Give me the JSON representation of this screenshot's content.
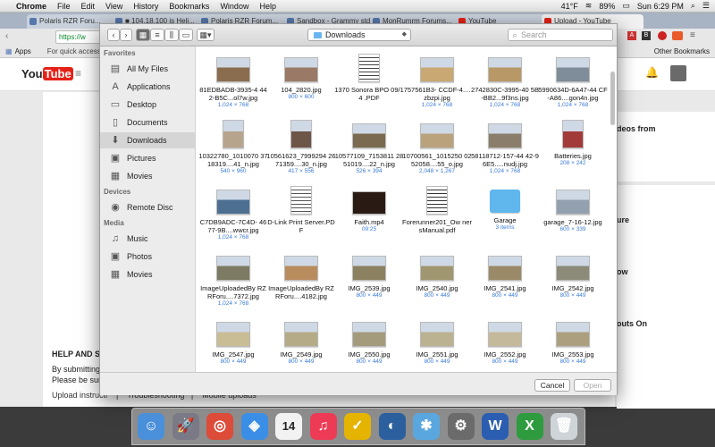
{
  "menubar": {
    "app": "Chrome",
    "items": [
      "File",
      "Edit",
      "View",
      "History",
      "Bookmarks",
      "Window",
      "Help"
    ],
    "temp": "41°F",
    "battery": "89%",
    "clock": "Sun 6:29 PM"
  },
  "browser": {
    "tabs": [
      "Polaris RZR Foru...",
      "■ 104.18.100 is Heli...",
      "Polaris RZR Forum...",
      "Sandbox - Grammy stde",
      "MonRumrm Forums...",
      "YouTube",
      ""
    ],
    "last_tab": "Upload - YouTube",
    "address_prefix": "https://w",
    "bookmarks_apps": "Apps",
    "bookmarks_hint": "For quick access, pl",
    "other_bookmarks": "Other Bookmarks"
  },
  "youtube": {
    "logo_you": "You",
    "logo_tube": "Tube",
    "side_texts": [
      "deos from",
      "ure",
      "ow",
      "outs On"
    ],
    "help_title": "HELP AND SU",
    "help_lines": [
      "By submitting",
      "Please be sur"
    ],
    "help_links": "Upload instructi    |    Troubleshooting   |    Mobile uploads"
  },
  "dialog": {
    "location": "Downloads",
    "search_placeholder": "Search",
    "sidebar": {
      "favorites_label": "Favorites",
      "favorites": [
        {
          "label": "All My Files",
          "icon": "all-files-icon",
          "glyph": "▤"
        },
        {
          "label": "Applications",
          "icon": "applications-icon",
          "glyph": "A"
        },
        {
          "label": "Desktop",
          "icon": "desktop-icon",
          "glyph": "▭"
        },
        {
          "label": "Documents",
          "icon": "documents-icon",
          "glyph": "▯"
        },
        {
          "label": "Downloads",
          "icon": "downloads-icon",
          "glyph": "⬇"
        },
        {
          "label": "Pictures",
          "icon": "pictures-icon",
          "glyph": "▣"
        },
        {
          "label": "Movies",
          "icon": "movies-icon",
          "glyph": "▦"
        }
      ],
      "devices_label": "Devices",
      "devices": [
        {
          "label": "Remote Disc",
          "icon": "disc-icon",
          "glyph": "◉"
        }
      ],
      "media_label": "Media",
      "media": [
        {
          "label": "Music",
          "icon": "music-icon",
          "glyph": "♫"
        },
        {
          "label": "Photos",
          "icon": "photos-icon",
          "glyph": "▣"
        },
        {
          "label": "Movies",
          "icon": "movies-icon",
          "glyph": "▦"
        }
      ]
    },
    "files": [
      {
        "name": "81EDBADB-3935-4 442-B5C...ol7w.jpg",
        "meta": "1,024 × 768",
        "kind": "photo",
        "color": "#8a6d4f"
      },
      {
        "name": "104_2820.jpg",
        "meta": "800 × 600",
        "kind": "photo",
        "color": "#9a7a66"
      },
      {
        "name": "1370 Sonora BPO 09/14 .PDF",
        "meta": "",
        "kind": "pdf",
        "color": "#444444"
      },
      {
        "name": "757561B3- CCDF-4....zbzpi.jpg",
        "meta": "1,024 × 768",
        "kind": "photo",
        "color": "#c9a873"
      },
      {
        "name": "2742830C-3995-40 5B-BB2...9f3ns.jpg",
        "meta": "1,024 × 768",
        "kind": "photo",
        "color": "#b79866"
      },
      {
        "name": "5990634D-6A47-44 CF-A86....gon4n.jpg",
        "meta": "1,024 × 768",
        "kind": "photo",
        "color": "#7f8c99"
      },
      {
        "name": "10322780_1010070 3718319....41_n.jpg",
        "meta": "540 × 960",
        "kind": "photo",
        "color": "#b7a48d"
      },
      {
        "name": "10561623_7999294 2671359....30_n.jpg",
        "meta": "417 × 556",
        "kind": "photo",
        "color": "#6d5548"
      },
      {
        "name": "10577109_7153811 2851019....22_n.jpg",
        "meta": "526 × 394",
        "kind": "photo",
        "color": "#7a6a50"
      },
      {
        "name": "10700561_1015250 0252058....55_o.jpg",
        "meta": "2,048 × 1,267",
        "kind": "photo",
        "color": "#b9a27c"
      },
      {
        "name": "58118712-157-44 42-96E5.....nudj.jpg",
        "meta": "1,024 × 768",
        "kind": "photo",
        "color": "#8b7d6b"
      },
      {
        "name": "Batteries.jpg",
        "meta": "208 × 242",
        "kind": "photo",
        "color": "#a33a3a"
      },
      {
        "name": "C7DB9ADC-7C4D- 4677-9B....wwcr.jpg",
        "meta": "1,024 × 768",
        "kind": "photo",
        "color": "#4d6f92"
      },
      {
        "name": "D-Link Print Server.PDF",
        "meta": "",
        "kind": "pdf",
        "color": "#555555"
      },
      {
        "name": "Faith.mp4",
        "meta": "09:25",
        "kind": "video",
        "color": "#2a1a14"
      },
      {
        "name": "Forerunner201_Ow nersManual.pdf",
        "meta": "",
        "kind": "doc",
        "color": "#333333"
      },
      {
        "name": "Garage",
        "meta": "3 items",
        "kind": "folder",
        "color": "#5fb7ee"
      },
      {
        "name": "garage_7-16-12.jpg",
        "meta": "600 × 339",
        "kind": "photo",
        "color": "#93a0b0"
      },
      {
        "name": "ImageUploadedBy RZRForu....7372.jpg",
        "meta": "1,024 × 768",
        "kind": "photo",
        "color": "#7c7a62"
      },
      {
        "name": "ImageUploadedBy RZRForu....4182.jpg",
        "meta": "",
        "kind": "photo",
        "color": "#b98c5e"
      },
      {
        "name": "IMG_2539.jpg",
        "meta": "800 × 449",
        "kind": "photo",
        "color": "#8b8060"
      },
      {
        "name": "IMG_2540.jpg",
        "meta": "800 × 449",
        "kind": "photo",
        "color": "#a09770"
      },
      {
        "name": "IMG_2541.jpg",
        "meta": "800 × 449",
        "kind": "photo",
        "color": "#9a8a68"
      },
      {
        "name": "IMG_2542.jpg",
        "meta": "800 × 449",
        "kind": "photo",
        "color": "#8c8b7a"
      },
      {
        "name": "IMG_2547.jpg",
        "meta": "800 × 449",
        "kind": "photo",
        "color": "#c9bd95"
      },
      {
        "name": "IMG_2549.jpg",
        "meta": "800 × 449",
        "kind": "photo",
        "color": "#b5ab86"
      },
      {
        "name": "IMG_2550.jpg",
        "meta": "800 × 449",
        "kind": "photo",
        "color": "#a49b7c"
      },
      {
        "name": "IMG_2551.jpg",
        "meta": "800 × 449",
        "kind": "photo",
        "color": "#bab290"
      },
      {
        "name": "IMG_2552.jpg",
        "meta": "800 × 449",
        "kind": "photo",
        "color": "#c4b99a"
      },
      {
        "name": "IMG_2553.jpg",
        "meta": "800 × 449",
        "kind": "photo",
        "color": "#ab9f80"
      }
    ],
    "cancel": "Cancel",
    "open": "Open"
  },
  "dock": {
    "apps": [
      {
        "name": "finder-icon",
        "glyph": "☺",
        "color": "#4a8fd9"
      },
      {
        "name": "launchpad-icon",
        "glyph": "🚀",
        "color": "#7a7a86"
      },
      {
        "name": "chrome-icon",
        "glyph": "◎",
        "color": "#dd4b39"
      },
      {
        "name": "safari-icon",
        "glyph": "◈",
        "color": "#3a8ee6"
      },
      {
        "name": "calendar-icon",
        "glyph": "14",
        "color": "#f2f2f2"
      },
      {
        "name": "itunes-icon",
        "glyph": "♫",
        "color": "#ee3b55"
      },
      {
        "name": "norton-icon",
        "glyph": "✓",
        "color": "#e5b400"
      },
      {
        "name": "google-earth-icon",
        "glyph": "◐",
        "color": "#2b5f9e"
      },
      {
        "name": "xcode-icon",
        "glyph": "✱",
        "color": "#5aa7e0"
      },
      {
        "name": "system-preferences-icon",
        "glyph": "⚙",
        "color": "#6b6b6b"
      },
      {
        "name": "word-icon",
        "glyph": "W",
        "color": "#2b5eb0"
      },
      {
        "name": "excel-icon",
        "glyph": "X",
        "color": "#2f9b3f"
      },
      {
        "name": "trash-icon",
        "glyph": "🗑",
        "color": "#cfd4d9"
      }
    ]
  }
}
